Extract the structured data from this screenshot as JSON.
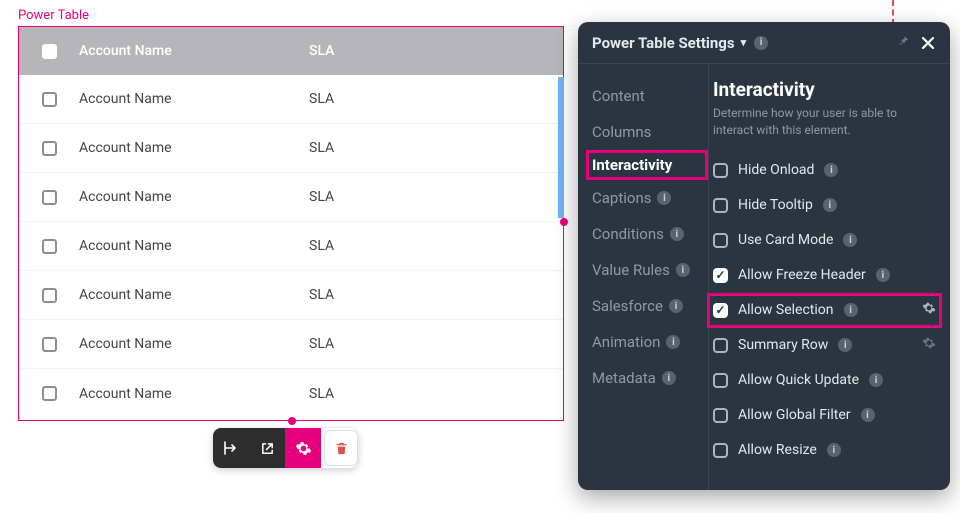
{
  "component_label": "Power Table",
  "table": {
    "headers": {
      "name": "Account Name",
      "sla": "SLA"
    },
    "rows": [
      {
        "name": "Account Name",
        "sla": "SLA"
      },
      {
        "name": "Account Name",
        "sla": "SLA"
      },
      {
        "name": "Account Name",
        "sla": "SLA"
      },
      {
        "name": "Account Name",
        "sla": "SLA"
      },
      {
        "name": "Account Name",
        "sla": "SLA"
      },
      {
        "name": "Account Name",
        "sla": "SLA"
      },
      {
        "name": "Account Name",
        "sla": "SLA"
      }
    ]
  },
  "panel": {
    "title": "Power Table Settings",
    "sidebar": [
      {
        "label": "Content",
        "info": false
      },
      {
        "label": "Columns",
        "info": false
      },
      {
        "label": "Interactivity",
        "info": false,
        "active": true,
        "highlight": true
      },
      {
        "label": "Captions",
        "info": true
      },
      {
        "label": "Conditions",
        "info": true
      },
      {
        "label": "Value Rules",
        "info": true
      },
      {
        "label": "Salesforce",
        "info": true
      },
      {
        "label": "Animation",
        "info": true
      },
      {
        "label": "Metadata",
        "info": true
      }
    ],
    "section": {
      "heading": "Interactivity",
      "description": "Determine how your user is able to interact with this element.",
      "options": [
        {
          "label": "Hide Onload",
          "checked": false,
          "info": true,
          "gear": false
        },
        {
          "label": "Hide Tooltip",
          "checked": false,
          "info": true,
          "gear": false
        },
        {
          "label": "Use Card Mode",
          "checked": false,
          "info": true,
          "gear": false
        },
        {
          "label": "Allow Freeze Header",
          "checked": true,
          "info": true,
          "gear": false
        },
        {
          "label": "Allow Selection",
          "checked": true,
          "info": true,
          "gear": true,
          "highlight": true
        },
        {
          "label": "Summary Row",
          "checked": false,
          "info": true,
          "gear": true,
          "gear_dim": true
        },
        {
          "label": "Allow Quick Update",
          "checked": false,
          "info": true,
          "gear": false
        },
        {
          "label": "Allow Global Filter",
          "checked": false,
          "info": true,
          "gear": false
        },
        {
          "label": "Allow Resize",
          "checked": false,
          "info": true,
          "gear": false
        }
      ]
    }
  },
  "colors": {
    "magenta": "#e6007e",
    "panel_bg": "#2b3542"
  }
}
